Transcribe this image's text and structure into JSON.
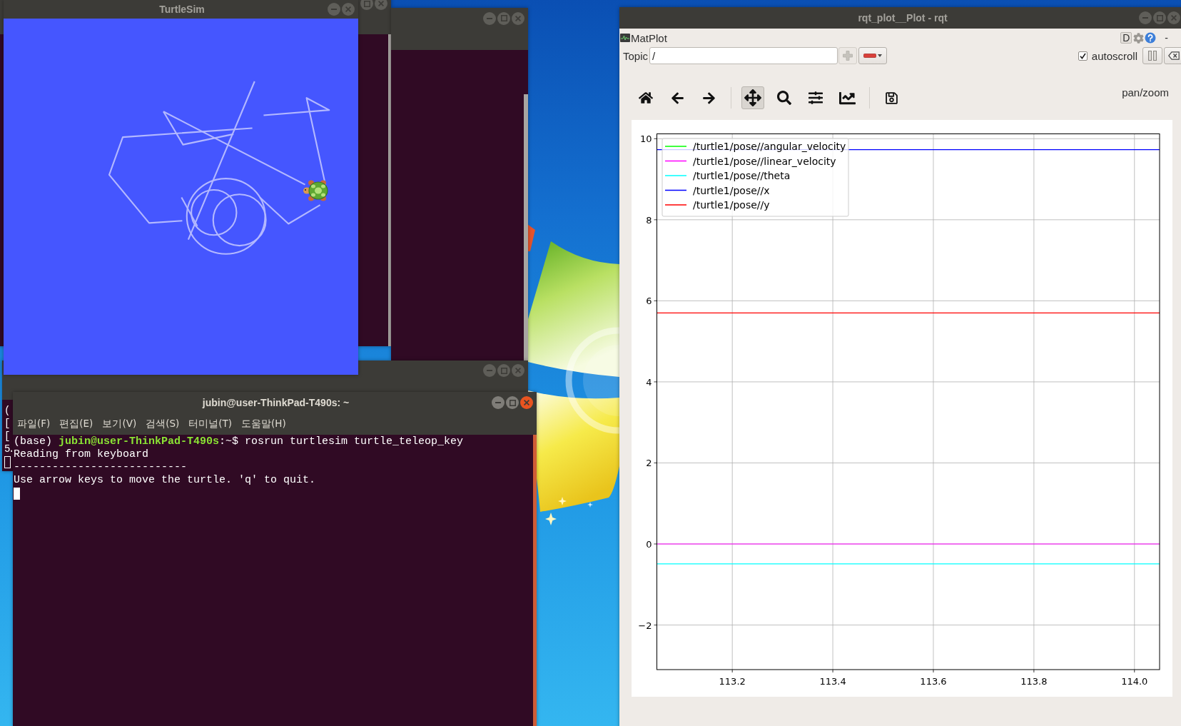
{
  "turtlesim": {
    "title": "TurtleSim",
    "focused": false
  },
  "left_terminal": {
    "focused": false,
    "lines": [
      "(",
      "[",
      "[",
      "5."
    ]
  },
  "terminal": {
    "title": "jubin@user-ThinkPad-T490s: ~",
    "focused": true,
    "menu": [
      "파일(F)",
      "편집(E)",
      "보기(V)",
      "검색(S)",
      "터미널(T)",
      "도움말(H)"
    ],
    "lines": [
      "(base) **jubin@user-ThinkPad-T490s**:~$ rosrun turtlesim turtle_teleop_key",
      "Reading from keyboard",
      "---------------------------",
      "Use arrow keys to move the turtle. 'q' to quit."
    ]
  },
  "rqt": {
    "title": "rqt_plot__Plot - rqt",
    "focused": false,
    "plugin": {
      "name": "MatPlot",
      "controls": [
        {
          "kind": "dock",
          "label": "D"
        },
        {
          "kind": "settings"
        },
        {
          "kind": "help"
        },
        {
          "kind": "minimize",
          "label": "-"
        }
      ]
    },
    "topic": {
      "label": "Topic",
      "value": "/"
    },
    "add_button": {
      "disabled": true
    },
    "remove_button": {
      "disabled": false
    },
    "autoscroll": {
      "label": "autoscroll",
      "checked": true
    },
    "toolbar": {
      "groups": [
        [
          {
            "kind": "home",
            "selected": false
          },
          {
            "kind": "back",
            "selected": false
          },
          {
            "kind": "forward",
            "selected": false
          }
        ],
        [
          {
            "kind": "pan",
            "selected": true
          },
          {
            "kind": "zoom",
            "selected": false
          },
          {
            "kind": "subplots",
            "selected": false
          },
          {
            "kind": "axes",
            "selected": false
          }
        ],
        [
          {
            "kind": "save",
            "selected": false
          }
        ]
      ],
      "message": "pan/zoom"
    },
    "plot": {
      "chart_data": {
        "type": "line",
        "x": [
          113.05,
          114.05
        ],
        "series": [
          {
            "name": "/turtle1/pose//angular_velocity",
            "color": "#00ff00",
            "values": [
              null,
              null
            ]
          },
          {
            "name": "/turtle1/pose//linear_velocity",
            "color": "#ff00ff",
            "values": [
              0,
              0
            ]
          },
          {
            "name": "/turtle1/pose//theta",
            "color": "#00ffff",
            "values": [
              -0.49,
              -0.49
            ]
          },
          {
            "name": "/turtle1/pose//x",
            "color": "#0000ff",
            "values": [
              9.73,
              9.73
            ]
          },
          {
            "name": "/turtle1/pose//y",
            "color": "#ff0000",
            "values": [
              5.7,
              5.7
            ]
          }
        ],
        "xlim": [
          113.05,
          114.05
        ],
        "ylim": [
          -3.1,
          10.12
        ],
        "xticks": [
          113.2,
          113.4,
          113.6,
          113.8,
          {
            "value": 114,
            "label": "114.0"
          }
        ],
        "yticks": [
          {
            "value": -2,
            "label": "−2"
          },
          0,
          2,
          4,
          6,
          8,
          10
        ],
        "grid": true,
        "legend": "upper left"
      }
    }
  }
}
